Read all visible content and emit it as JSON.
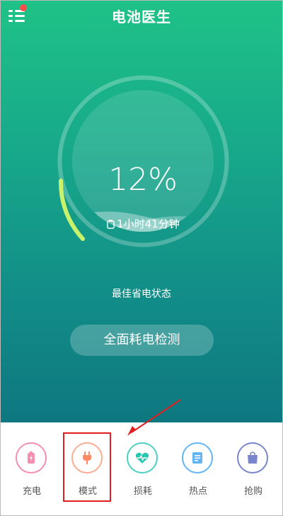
{
  "app": {
    "title": "电池医生"
  },
  "battery": {
    "percent": "12%",
    "remaining": "1小时41分钟",
    "status": "最佳省电状态",
    "level": 0.12
  },
  "actions": {
    "full_check": "全面耗电检测"
  },
  "bottom_nav": [
    {
      "label": "充电",
      "icon": "battery-charge-icon",
      "color": "#f48fb1"
    },
    {
      "label": "模式",
      "icon": "plug-icon",
      "color": "#ffab91"
    },
    {
      "label": "损耗",
      "icon": "heart-pulse-icon",
      "color": "#4dd0c4"
    },
    {
      "label": "热点",
      "icon": "document-icon",
      "color": "#64b5f6"
    },
    {
      "label": "抢购",
      "icon": "shopping-bag-icon",
      "color": "#7986cb"
    }
  ],
  "colors": {
    "accent": "#1fc287",
    "gauge_fill": "#c8f26b",
    "highlight": "#e02020"
  }
}
